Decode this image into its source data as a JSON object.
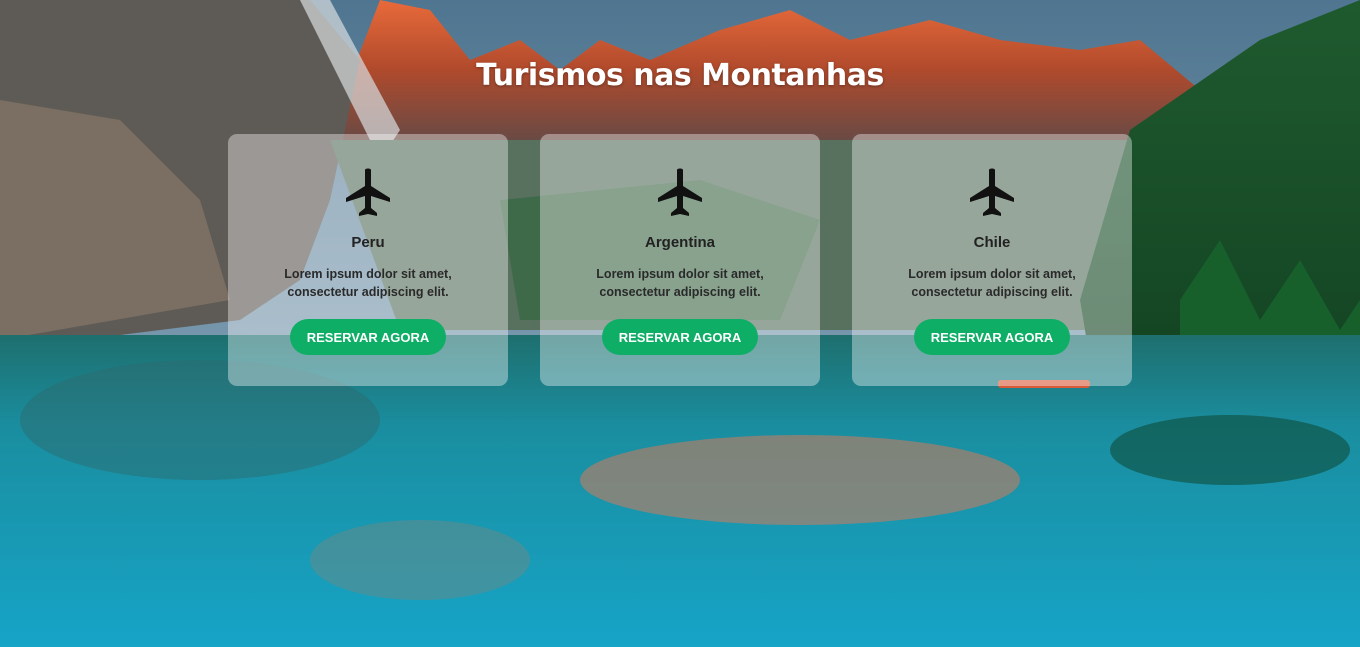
{
  "page": {
    "title": "Turismos nas Montanhas"
  },
  "colors": {
    "button_bg": "#0fae67",
    "button_text": "#ffffff",
    "card_bg": "rgba(255,255,255,0.38)"
  },
  "cards": [
    {
      "icon": "airplane-icon",
      "title": "Peru",
      "text": "Lorem ipsum dolor sit amet, consectetur adipiscing elit.",
      "button_label": "RESERVAR AGORA"
    },
    {
      "icon": "airplane-icon",
      "title": "Argentina",
      "text": "Lorem ipsum dolor sit amet, consectetur adipiscing elit.",
      "button_label": "RESERVAR AGORA"
    },
    {
      "icon": "airplane-icon",
      "title": "Chile",
      "text": "Lorem ipsum dolor sit amet, consectetur adipiscing elit.",
      "button_label": "RESERVAR AGORA"
    }
  ]
}
